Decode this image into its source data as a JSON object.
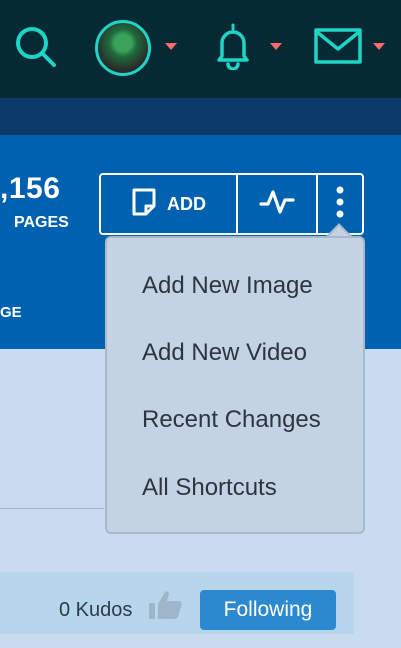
{
  "header": {
    "icons": [
      "search-icon",
      "avatar",
      "bell-icon",
      "mail-icon"
    ],
    "accent": "#1fd3c6",
    "caret_color": "#ff6b6b"
  },
  "hero": {
    "stat_number": ",156",
    "stat_label": "PAGES",
    "partial_label": "GE"
  },
  "toolbar": {
    "add_label": "ADD",
    "icons": [
      "page-icon",
      "activity-icon",
      "more-vertical-icon"
    ]
  },
  "dropdown": {
    "items": [
      "Add New Image",
      "Add New Video",
      "Recent Changes",
      "All Shortcuts"
    ]
  },
  "footer": {
    "kudos_text": "0 Kudos",
    "following_label": "Following"
  }
}
